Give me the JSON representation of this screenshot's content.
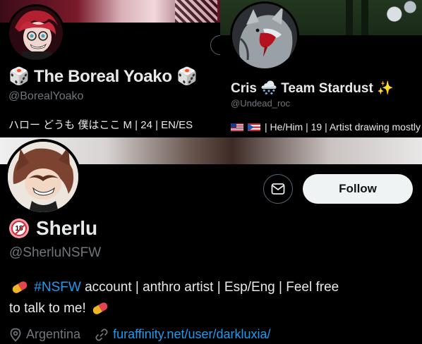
{
  "card1": {
    "name_prefix_icon": "🎲",
    "name": "The Boreal Yoako",
    "name_suffix_icon": "🎲",
    "handle": "@BorealYoako",
    "bio": "ハロー どうも 僕はここ M | 24 | EN/ES"
  },
  "card2": {
    "name": "Cris",
    "team_icon": "🌨️",
    "team_text": "Team Stardust",
    "sparkle": "✨",
    "handle": "@Undead_roc",
    "bio": "| He/Him | 19 | Artist drawing mostly"
  },
  "card3": {
    "badge_text": "18",
    "name": "Sherlu",
    "handle": "@SherluNSFW",
    "bio_hashtag": "#NSFW",
    "bio_part1": "account | anthro artist | Esp/Eng | Feel free",
    "bio_part2": "to talk to me!",
    "location": "Argentina",
    "link": "furaffinity.net/user/darkluxia/",
    "follow_label": "Follow"
  },
  "colors": {
    "background": "#000000",
    "text": "#e7e9ea",
    "muted": "#71767b",
    "link": "#1d9bf0",
    "follow_bg": "#eff3f4"
  }
}
